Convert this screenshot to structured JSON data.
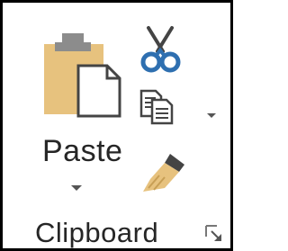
{
  "clipboard_group": {
    "paste_label": "Paste",
    "group_label": "Clipboard",
    "icons": {
      "paste": "paste-icon",
      "cut": "scissors-icon",
      "copy": "copy-icon",
      "format_painter": "format-painter-icon",
      "dropdown": "chevron-down-icon",
      "launcher": "dialog-launcher-icon"
    },
    "colors": {
      "clipboard_body": "#E7C27E",
      "clipboard_clip": "#8C8C8C",
      "scissors": "#2E6FB0",
      "brush_handle": "#444444",
      "brush_bristles": "#E7C27E",
      "text": "#262626",
      "border": "#000000"
    }
  }
}
